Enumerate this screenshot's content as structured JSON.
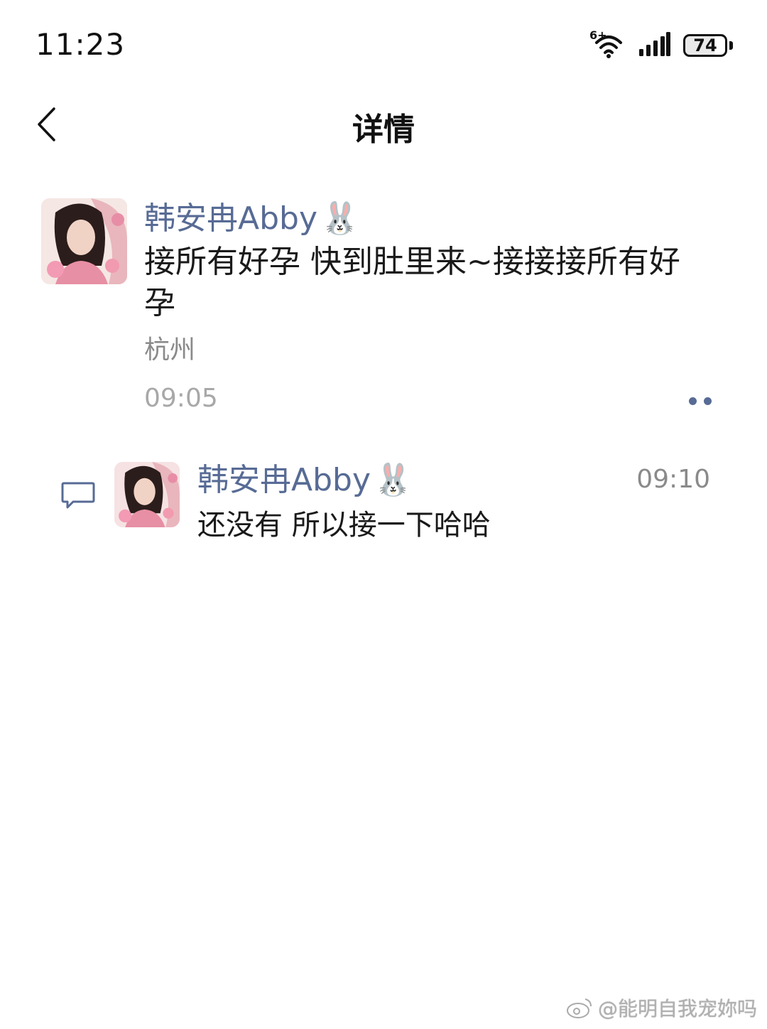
{
  "status_bar": {
    "time": "11:23",
    "network_tag": "6+",
    "battery_level": "74"
  },
  "header": {
    "title": "详情"
  },
  "post": {
    "username": "韩安冉Abby",
    "username_emoji": "🐰",
    "text": "接所有好孕 快到肚里来~接接接所有好孕",
    "location": "杭州",
    "time": "09:05"
  },
  "comment": {
    "username": "韩安冉Abby",
    "username_emoji": "🐰",
    "time": "09:10",
    "text": "还没有 所以接一下哈哈"
  },
  "watermark": {
    "text": "@能明自我宠妳吗"
  },
  "colors": {
    "link_blue": "#576b95",
    "muted_gray": "#8a8a8a"
  }
}
